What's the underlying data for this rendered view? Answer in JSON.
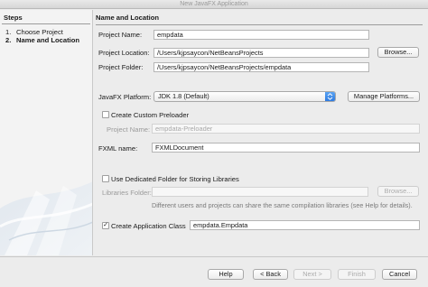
{
  "window": {
    "title": "New JavaFX Application"
  },
  "steps": {
    "heading": "Steps",
    "items": [
      {
        "num": "1.",
        "label": "Choose Project",
        "current": false
      },
      {
        "num": "2.",
        "label": "Name and Location",
        "current": true
      }
    ]
  },
  "main": {
    "heading": "Name and Location",
    "project_name": {
      "label": "Project Name:",
      "value": "empdata"
    },
    "project_location": {
      "label": "Project Location:",
      "value": "/Users/kjpsaycon/NetBeansProjects",
      "button": "Browse..."
    },
    "project_folder": {
      "label": "Project Folder:",
      "value": "/Users/kjpsaycon/NetBeansProjects/empdata"
    },
    "platform": {
      "label": "JavaFX Platform:",
      "value": "JDK 1.8 (Default)",
      "button": "Manage Platforms..."
    },
    "preloader": {
      "checkbox_label": "Create Custom Preloader",
      "checked": false,
      "project_label": "Project Name:",
      "project_value": "empdata-Preloader"
    },
    "fxml": {
      "label": "FXML name:",
      "value": "FXMLDocument"
    },
    "libraries": {
      "checkbox_label": "Use Dedicated Folder for Storing Libraries",
      "checked": false,
      "folder_label": "Libraries Folder:",
      "folder_value": "",
      "button": "Browse...",
      "hint_line1": "Different users and projects can share the same compilation libraries (see Help for details)."
    },
    "app_class": {
      "checkbox_label": "Create Application Class",
      "checked": true,
      "check_glyph": "✓",
      "value": "empdata.Empdata"
    }
  },
  "footer": {
    "help": "Help",
    "back": "< Back",
    "next": "Next >",
    "finish": "Finish",
    "cancel": "Cancel"
  },
  "icons": {
    "dropdown": "chevron-updown-icon"
  },
  "colors": {
    "accent": "#2f7be0"
  }
}
